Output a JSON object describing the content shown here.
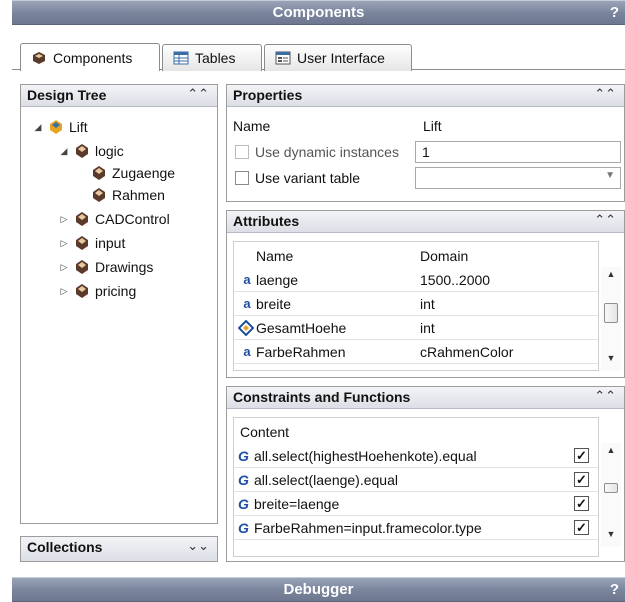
{
  "components_titlebar": {
    "title": "Components",
    "help": "?"
  },
  "tabs": [
    {
      "label": "Components",
      "icon": "component-icon",
      "active": true
    },
    {
      "label": "Tables",
      "icon": "table-icon",
      "active": false
    },
    {
      "label": "User Interface",
      "icon": "user-interface-icon",
      "active": false
    }
  ],
  "design_tree": {
    "title": "Design Tree",
    "nodes": [
      {
        "label": "Lift",
        "toggle": "◢",
        "icon": "lift-component-icon"
      },
      {
        "label": "logic",
        "toggle": "◢",
        "icon": "component-icon"
      },
      {
        "label": "Zugaenge",
        "toggle": "",
        "icon": "component-icon"
      },
      {
        "label": "Rahmen",
        "toggle": "",
        "icon": "component-icon"
      },
      {
        "label": "CADControl",
        "toggle": "▷",
        "icon": "component-icon"
      },
      {
        "label": "input",
        "toggle": "▷",
        "icon": "component-icon"
      },
      {
        "label": "Drawings",
        "toggle": "▷",
        "icon": "component-icon"
      },
      {
        "label": "pricing",
        "toggle": "▷",
        "icon": "component-icon"
      }
    ]
  },
  "collections": {
    "title": "Collections"
  },
  "properties": {
    "title": "Properties",
    "name_label": "Name",
    "name_value": "Lift",
    "dynamic_label": "Use dynamic instances",
    "dynamic_value": "1",
    "variant_label": "Use variant table",
    "variant_value": ""
  },
  "attributes": {
    "title": "Attributes",
    "columns": [
      "Name",
      "Domain"
    ],
    "rows": [
      {
        "icon": "a",
        "name": "laenge",
        "domain": "1500..2000"
      },
      {
        "icon": "a",
        "name": "breite",
        "domain": "int"
      },
      {
        "icon": "derived",
        "name": "GesamtHoehe",
        "domain": "int"
      },
      {
        "icon": "a",
        "name": "FarbeRahmen",
        "domain": "cRahmenColor"
      }
    ]
  },
  "constraints": {
    "title": "Constraints and Functions",
    "column": "Content",
    "rows": [
      {
        "content": "all.select(highestHoehenkote).equal",
        "checked": true
      },
      {
        "content": "all.select(laenge).equal",
        "checked": true
      },
      {
        "content": "breite=laenge",
        "checked": true
      },
      {
        "content": "FarbeRahmen=input.framecolor.type",
        "checked": true
      }
    ]
  },
  "debugger_titlebar": {
    "title": "Debugger",
    "help": "?"
  },
  "colors": {
    "titlebar": "#7b869d",
    "accent": "#1e4fa0"
  }
}
